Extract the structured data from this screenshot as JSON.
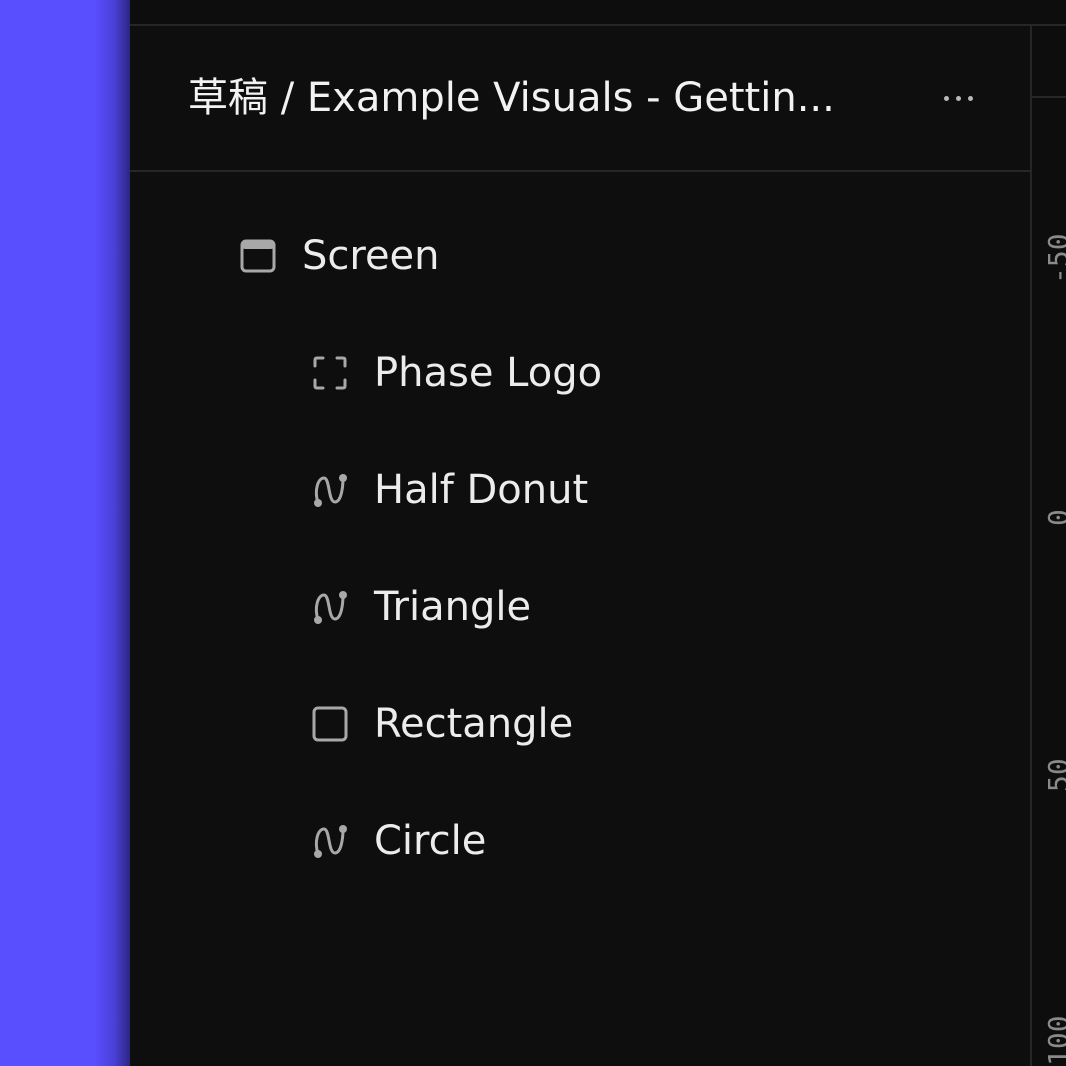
{
  "header": {
    "breadcrumb": "草稿 / Example Visuals - Gettin...",
    "more_label": "More options"
  },
  "layers": [
    {
      "label": "Screen",
      "icon": "screen-icon",
      "depth": 0
    },
    {
      "label": "Phase Logo",
      "icon": "frame-bracket-icon",
      "depth": 1
    },
    {
      "label": "Half Donut",
      "icon": "path-icon",
      "depth": 1
    },
    {
      "label": "Triangle",
      "icon": "path-icon",
      "depth": 1
    },
    {
      "label": "Rectangle",
      "icon": "rectangle-icon",
      "depth": 1
    },
    {
      "label": "Circle",
      "icon": "path-icon",
      "depth": 1
    }
  ],
  "ruler": {
    "ticks": [
      "-50",
      "0",
      "50",
      "100"
    ]
  },
  "colors": {
    "accent": "#5a4fff",
    "panel_bg": "#0e0e0e",
    "text": "#ececec",
    "icon": "#a8a8a8"
  }
}
